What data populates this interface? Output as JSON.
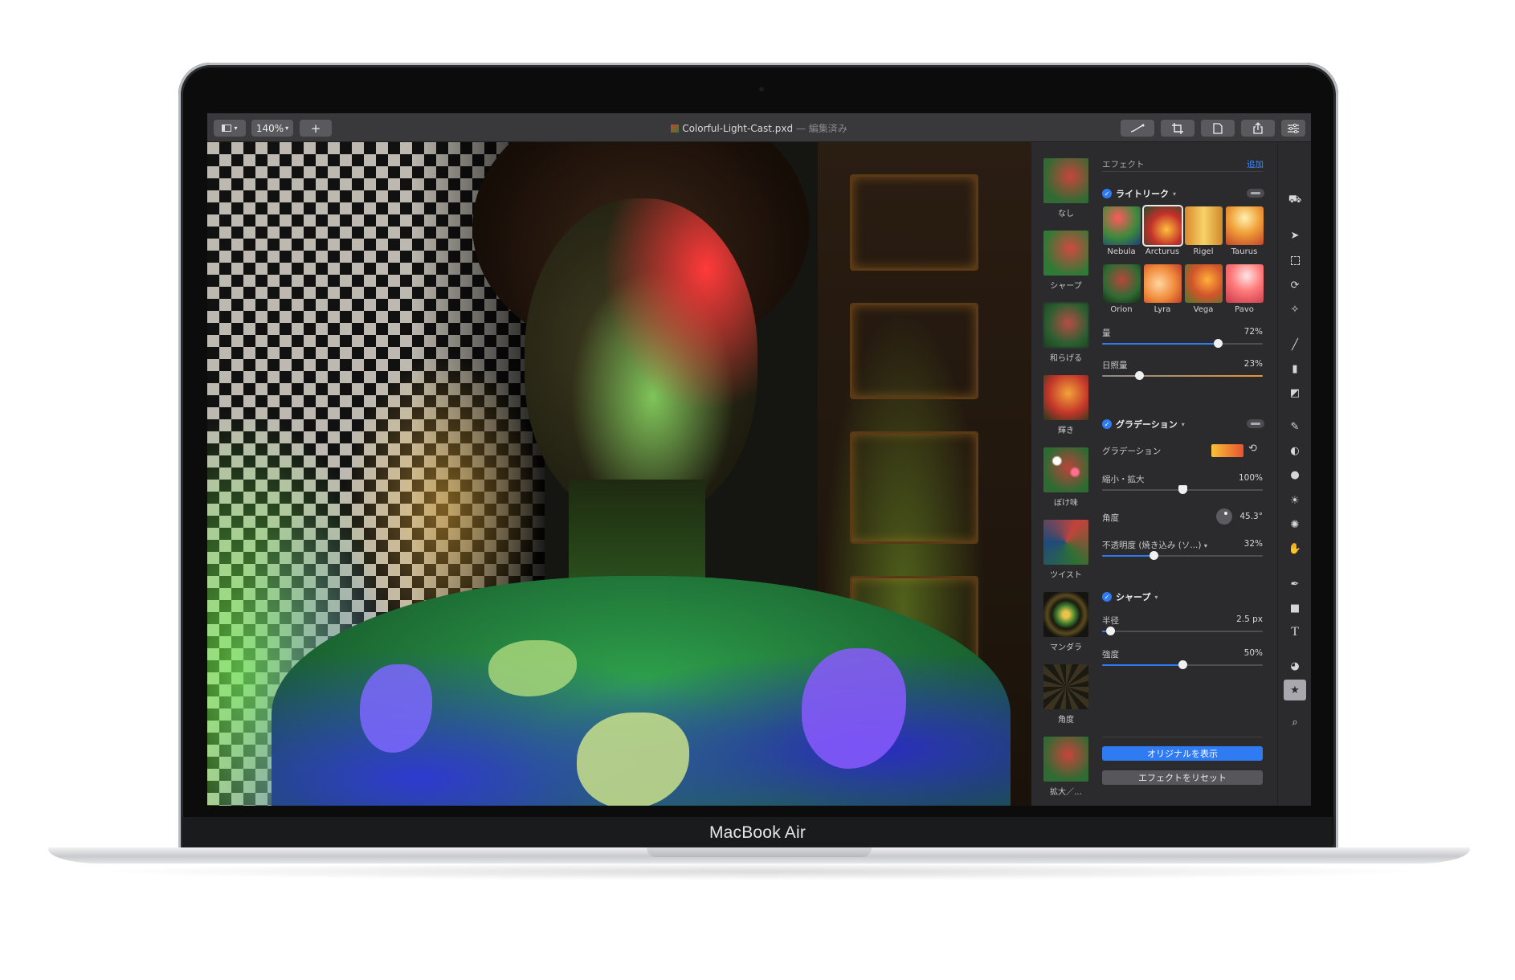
{
  "device": {
    "label": "MacBook Air"
  },
  "titlebar": {
    "view_button_icon": "sidebar-icon",
    "zoom_label": "140%",
    "add_label": "+",
    "filename": "Colorful-Light-Cast.pxd",
    "separator": " — ",
    "status": "編集済み",
    "tools": [
      "pen-icon",
      "crop-icon",
      "document-icon",
      "share-icon",
      "sliders-icon"
    ]
  },
  "filmstrip": {
    "items": [
      {
        "label": "なし"
      },
      {
        "label": "シャープ"
      },
      {
        "label": "和らげる"
      },
      {
        "label": "輝き"
      },
      {
        "label": "ぼけ味"
      },
      {
        "label": "ツイスト"
      },
      {
        "label": "マンダラ"
      },
      {
        "label": "角度"
      },
      {
        "label": "拡大／…"
      }
    ]
  },
  "inspector": {
    "header": {
      "title": "エフェクト",
      "add_label": "追加"
    },
    "light_leak": {
      "title": "ライトリーク",
      "presets_row1": [
        "Nebula",
        "Arcturus",
        "Rigel",
        "Taurus"
      ],
      "presets_row2": [
        "Orion",
        "Lyra",
        "Vega",
        "Pavo"
      ],
      "selected_preset": "Arcturus",
      "amount": {
        "label": "量",
        "value": "72%",
        "level": 0.72
      },
      "sunlight": {
        "label": "日照量",
        "value": "23%",
        "level": 0.23
      }
    },
    "gradation": {
      "title": "グラデーション",
      "gradient_label": "グラデーション",
      "scale": {
        "label": "縮小・拡大",
        "value": "100%",
        "level": 0.5
      },
      "angle": {
        "label": "角度",
        "value": "45.3°"
      },
      "opacity": {
        "label": "不透明度 (焼き込み (ソ...)",
        "value": "32%",
        "level": 0.32
      }
    },
    "sharpen": {
      "title": "シャープ",
      "radius": {
        "label": "半径",
        "value": "2.5 px",
        "level": 0.05
      },
      "intensity": {
        "label": "強度",
        "value": "50%",
        "level": 0.5
      }
    },
    "show_original_label": "オリジナルを表示",
    "reset_label": "エフェクトをリセット"
  },
  "tools": [
    "paint-bucket-icon",
    "arrow-select-icon",
    "rect-select-icon",
    "lasso-icon",
    "magic-wand-icon",
    "brush-icon",
    "fill-icon",
    "eraser-icon",
    "smudge-icon",
    "clone-icon",
    "blur-icon",
    "light-icon",
    "repair-icon",
    "hand-icon",
    "pen-tool-icon",
    "shape-icon",
    "text-icon",
    "color-icon",
    "effects-icon",
    "zoom-icon"
  ],
  "colors": {
    "accent": "#2f7bf3",
    "panel": "#2b2b2e",
    "titlebar": "#39393c"
  }
}
